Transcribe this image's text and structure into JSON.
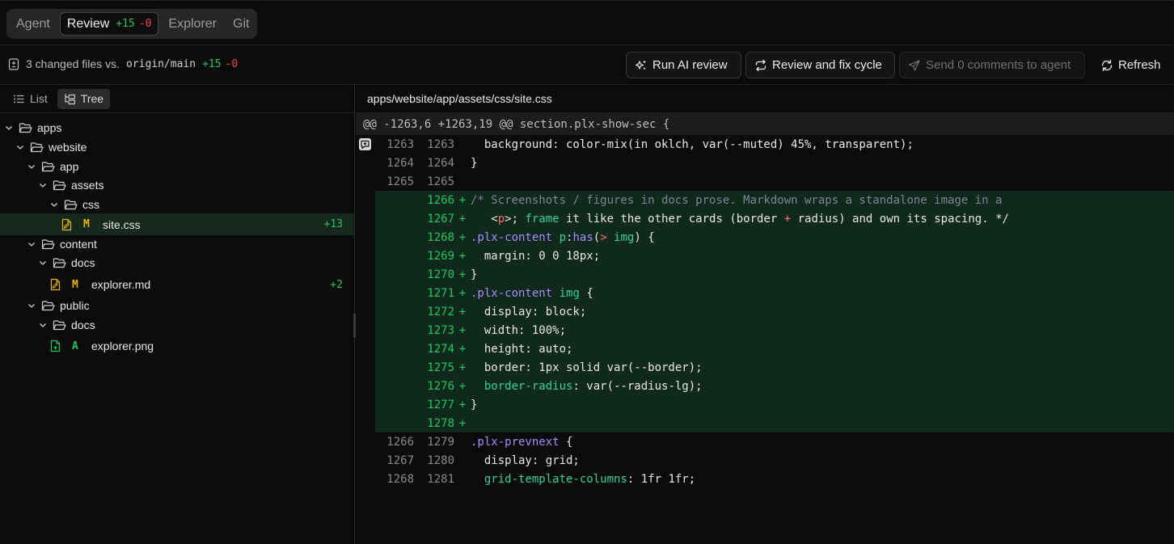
{
  "tabs": [
    {
      "label": "Agent",
      "active": false
    },
    {
      "label": "Review",
      "active": true,
      "additions": "+15",
      "deletions": "-0"
    },
    {
      "label": "Explorer",
      "active": false
    },
    {
      "label": "Git",
      "active": false
    }
  ],
  "summary": {
    "prefix": "3 changed files vs.",
    "ref": "origin/main",
    "additions": "+15",
    "deletions": "-0"
  },
  "actions": {
    "run_ai_review": "Run AI review",
    "review_fix_cycle": "Review and fix cycle",
    "send_comments": "Send 0 comments to agent",
    "refresh": "Refresh"
  },
  "view_toggle": {
    "list": "List",
    "tree": "Tree"
  },
  "tree": [
    {
      "name": "apps",
      "type": "folder"
    },
    {
      "name": "website",
      "type": "folder"
    },
    {
      "name": "app",
      "type": "folder"
    },
    {
      "name": "assets",
      "type": "folder"
    },
    {
      "name": "css",
      "type": "folder"
    },
    {
      "name": "site.css",
      "type": "file",
      "status": "M",
      "count": "+13"
    },
    {
      "name": "content",
      "type": "folder"
    },
    {
      "name": "docs",
      "type": "folder"
    },
    {
      "name": "explorer.md",
      "type": "file",
      "status": "M",
      "count": "+2"
    },
    {
      "name": "public",
      "type": "folder"
    },
    {
      "name": "docs",
      "type": "folder"
    },
    {
      "name": "explorer.png",
      "type": "file",
      "status": "A",
      "count": ""
    }
  ],
  "diff": {
    "file_path": "apps/website/app/assets/css/site.css",
    "hunk_header": "@@ -1263,6 +1263,19 @@ section.plx-show-sec {",
    "lines": [
      {
        "old": "1263",
        "new": "1263",
        "sign": "",
        "text": "  background: color-mix(in oklch, var(--muted) 45%, transparent);"
      },
      {
        "old": "1264",
        "new": "1264",
        "sign": "",
        "text": "}"
      },
      {
        "old": "1265",
        "new": "1265",
        "sign": "",
        "text": ""
      },
      {
        "old": "",
        "new": "1266",
        "sign": "+",
        "text": "/* Screenshots / figures in docs prose. Markdown wraps a standalone image in a"
      },
      {
        "old": "",
        "new": "1267",
        "sign": "+",
        "text": "   <p>; frame it like the other cards (border + radius) and own its spacing. */"
      },
      {
        "old": "",
        "new": "1268",
        "sign": "+",
        "text": ".plx-content p:has(> img) {"
      },
      {
        "old": "",
        "new": "1269",
        "sign": "+",
        "text": "  margin: 0 0 18px;"
      },
      {
        "old": "",
        "new": "1270",
        "sign": "+",
        "text": "}"
      },
      {
        "old": "",
        "new": "1271",
        "sign": "+",
        "text": ".plx-content img {"
      },
      {
        "old": "",
        "new": "1272",
        "sign": "+",
        "text": "  display: block;"
      },
      {
        "old": "",
        "new": "1273",
        "sign": "+",
        "text": "  width: 100%;"
      },
      {
        "old": "",
        "new": "1274",
        "sign": "+",
        "text": "  height: auto;"
      },
      {
        "old": "",
        "new": "1275",
        "sign": "+",
        "text": "  border: 1px solid var(--border);"
      },
      {
        "old": "",
        "new": "1276",
        "sign": "+",
        "text": "  border-radius: var(--radius-lg);"
      },
      {
        "old": "",
        "new": "1277",
        "sign": "+",
        "text": "}"
      },
      {
        "old": "",
        "new": "1278",
        "sign": "+",
        "text": ""
      },
      {
        "old": "1266",
        "new": "1279",
        "sign": "",
        "text": ".plx-prevnext {"
      },
      {
        "old": "1267",
        "new": "1280",
        "sign": "",
        "text": "  display: grid;"
      },
      {
        "old": "1268",
        "new": "1281",
        "sign": "",
        "text": "  grid-template-columns: 1fr 1fr;"
      }
    ]
  },
  "colors": {
    "added_bg": "#0f2a1c",
    "addition": "#22c55e",
    "deletion": "#ef4444",
    "modified": "#eab308"
  }
}
